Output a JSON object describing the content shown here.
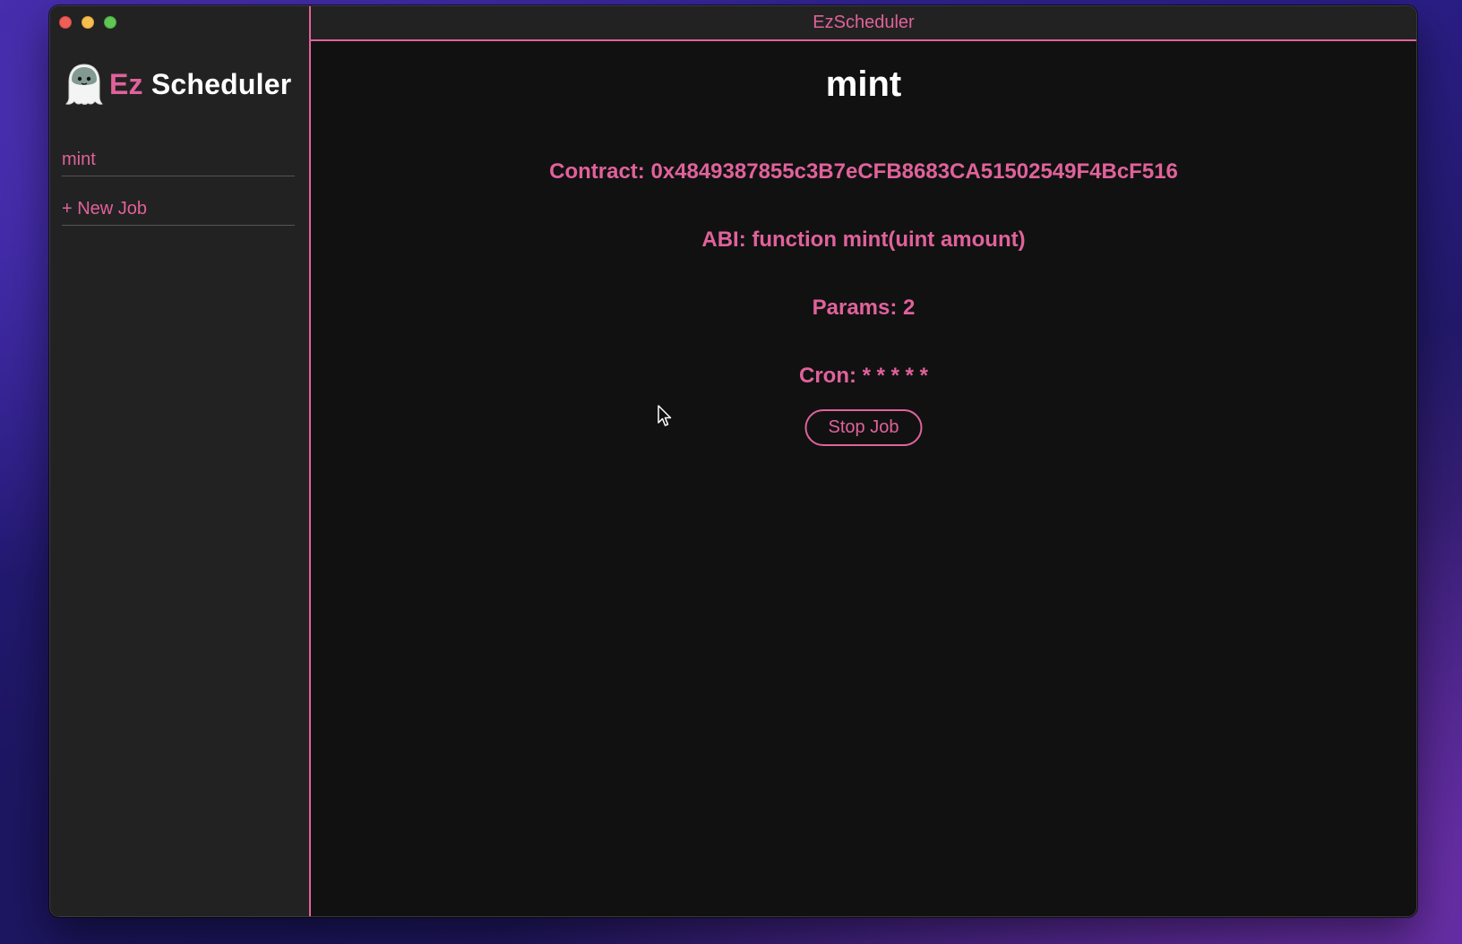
{
  "window": {
    "title": "EzScheduler"
  },
  "sidebar": {
    "brand_prefix": "Ez",
    "brand_suffix": "Scheduler",
    "logo_icon": "ghost-logo-icon",
    "items": [
      {
        "label": "mint"
      },
      {
        "label": "+ New Job"
      }
    ]
  },
  "job": {
    "title": "mint",
    "contract": "Contract: 0x4849387855c3B7eCFB8683CA51502549F4BcF516",
    "abi": "ABI: function mint(uint amount)",
    "params": "Params: 2",
    "cron": "Cron: * * * * *",
    "stop_label": "Stop Job"
  },
  "colors": {
    "accent": "#e0629b",
    "sidebar_bg": "#222222",
    "main_bg": "#111111"
  }
}
